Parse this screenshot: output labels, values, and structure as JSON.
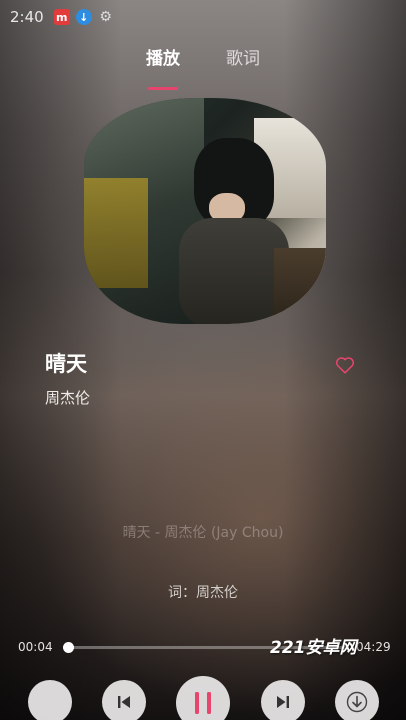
{
  "status_bar": {
    "time": "2:40",
    "icons": [
      "music-app-icon",
      "download-icon",
      "settings-gear-icon"
    ]
  },
  "tabs": [
    {
      "label": "播放",
      "active": true
    },
    {
      "label": "歌词",
      "active": false
    }
  ],
  "song": {
    "title": "晴天",
    "artist": "周杰伦",
    "favorite": false
  },
  "lyrics": {
    "header_line": "晴天 - 周杰伦 (Jay Chou)",
    "credit_line": "词：周杰伦"
  },
  "progress": {
    "elapsed": "00:04",
    "total": "04:29",
    "fraction": 0.015
  },
  "watermark": "221安卓网",
  "controls": [
    "play-mode-button",
    "previous-button",
    "pause-button",
    "next-button",
    "download-button"
  ],
  "colors": {
    "accent": "#e8456e",
    "heart": "#e8456e"
  }
}
